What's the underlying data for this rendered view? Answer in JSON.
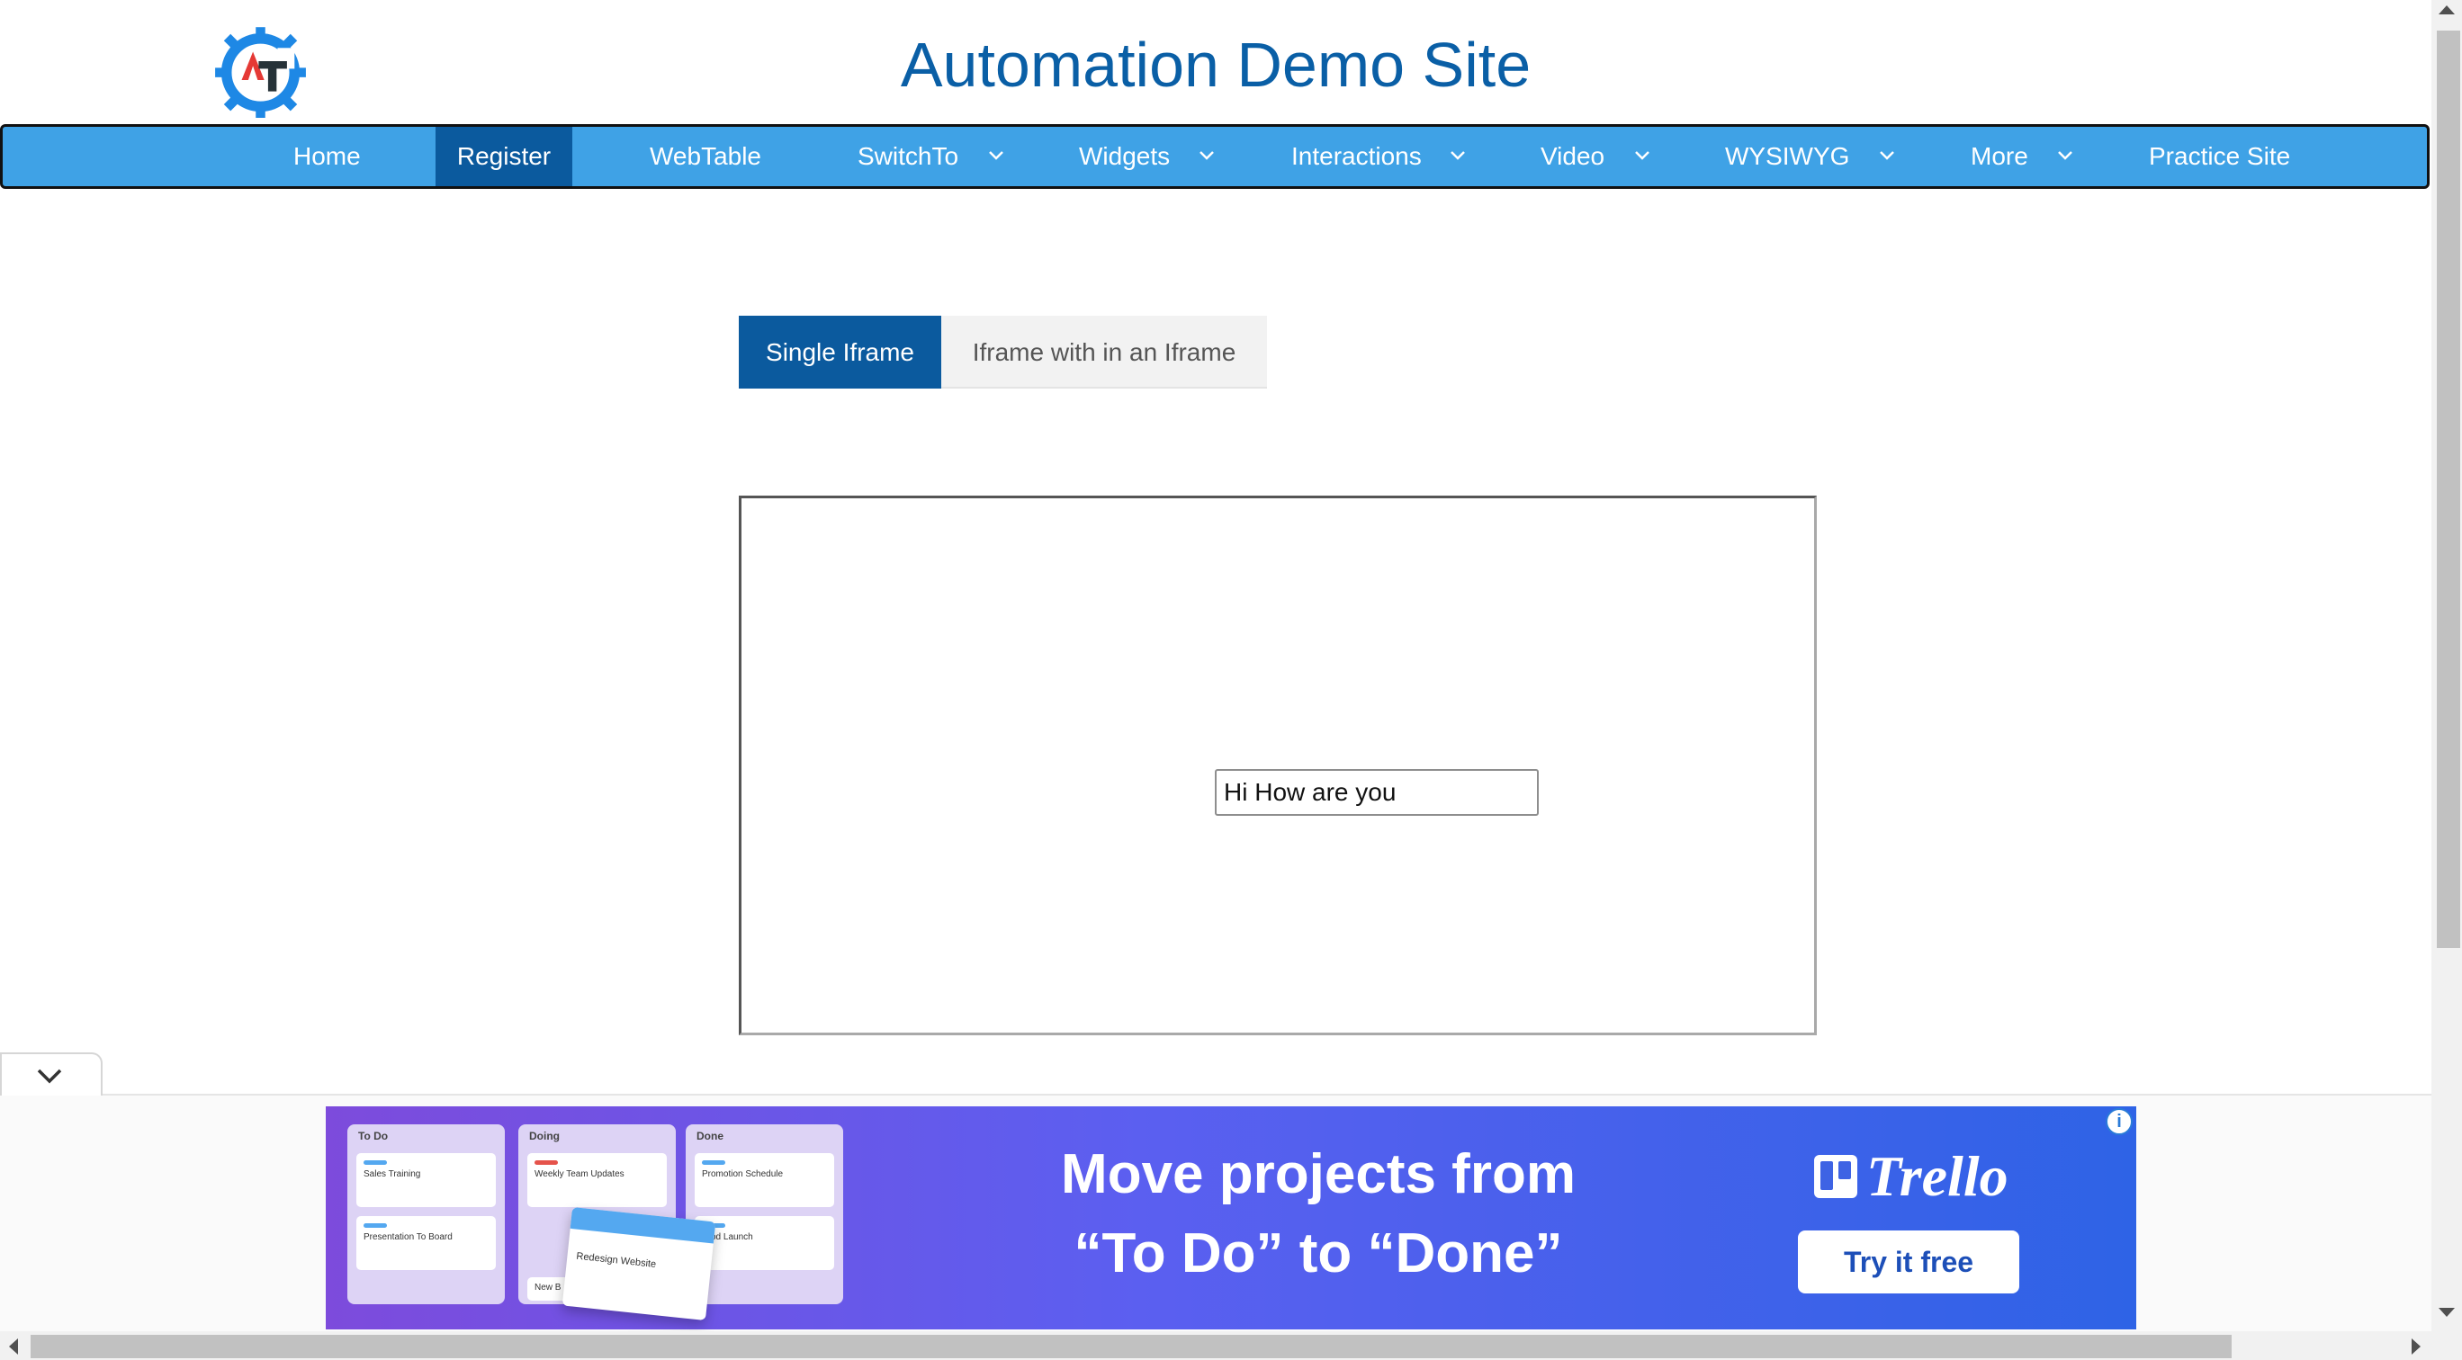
{
  "header": {
    "title": "Automation Demo Site",
    "logo_icon": "automation-testing-gear-logo",
    "logo_colors": {
      "gear": "#1e88e5",
      "a": "#e53935",
      "t": "#263238"
    }
  },
  "nav": {
    "items": [
      {
        "label": "Home",
        "dropdown": false
      },
      {
        "label": "Register",
        "dropdown": false,
        "active": true
      },
      {
        "label": "WebTable",
        "dropdown": false
      },
      {
        "label": "SwitchTo",
        "dropdown": true
      },
      {
        "label": "Widgets",
        "dropdown": true
      },
      {
        "label": "Interactions",
        "dropdown": true
      },
      {
        "label": "Video",
        "dropdown": true
      },
      {
        "label": "WYSIWYG",
        "dropdown": true
      },
      {
        "label": "More",
        "dropdown": true
      },
      {
        "label": "Practice Site",
        "dropdown": false
      }
    ],
    "background": "#3fa2e6",
    "active_background": "#0b5a9e"
  },
  "tabs": [
    {
      "label": "Single Iframe",
      "active": true
    },
    {
      "label": "Iframe with in an Iframe",
      "active": false
    }
  ],
  "iframe": {
    "input_value": "Hi How are you"
  },
  "ad": {
    "headline_line1": "Move projects from",
    "headline_line2": "“To Do” to “Done”",
    "brand": "Trello",
    "cta": "Try it free",
    "info_icon": "info-icon",
    "board_columns": [
      {
        "title": "To Do",
        "cards": [
          "Sales Training",
          "Presentation To Board"
        ]
      },
      {
        "title": "Doing",
        "cards": [
          "Weekly Team Updates",
          "New B"
        ]
      },
      {
        "title": "Done",
        "cards": [
          "Promotion Schedule",
          "Prod Launch"
        ]
      }
    ],
    "dragging_card": "Redesign Website",
    "gradient": [
      "#7d4bdc",
      "#2e63e6"
    ]
  },
  "ad_toggle_icon": "chevron-down-icon"
}
